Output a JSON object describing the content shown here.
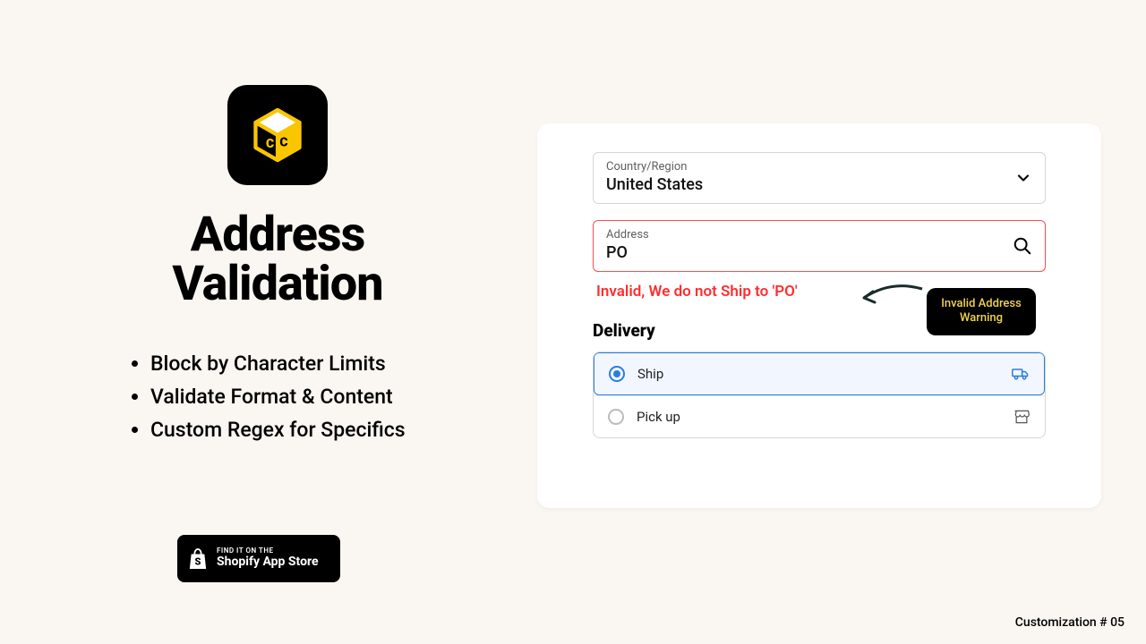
{
  "hero": {
    "title_l1": "Address",
    "title_l2": "Validation"
  },
  "features": [
    "Block by Character Limits",
    "Validate Format & Content",
    "Custom Regex for Specifics"
  ],
  "badge": {
    "small": "FIND IT ON THE",
    "big": "Shopify App Store"
  },
  "form": {
    "country_label": "Country/Region",
    "country_value": "United States",
    "address_label": "Address",
    "address_value": "PO",
    "error_msg": "Invalid, We do not Ship to 'PO'",
    "delivery_heading": "Delivery",
    "options": [
      {
        "label": "Ship",
        "selected": true,
        "icon": "truck"
      },
      {
        "label": "Pick up",
        "selected": false,
        "icon": "store"
      }
    ]
  },
  "annotation": {
    "line1": "Invalid Address",
    "line2": "Warning"
  },
  "footer": "Customization # 05"
}
